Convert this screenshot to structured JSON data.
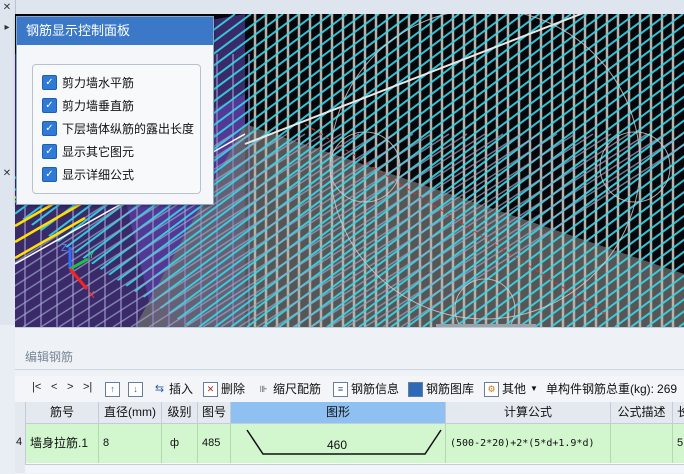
{
  "panel": {
    "title": "钢筋显示控制面板",
    "options": [
      {
        "label": "剪力墙水平筋",
        "checked": true
      },
      {
        "label": "剪力墙垂直筋",
        "checked": true
      },
      {
        "label": "下层墙体纵筋的露出长度",
        "checked": true
      },
      {
        "label": "显示其它图元",
        "checked": true
      },
      {
        "label": "显示详细公式",
        "checked": true
      }
    ]
  },
  "axis": {
    "z": "Z",
    "y": "Y",
    "x": "X"
  },
  "edit": {
    "title": "编辑钢筋",
    "toolbar": {
      "nav_first": "|<",
      "nav_prev": "<",
      "nav_next": ">",
      "nav_last": ">|",
      "insert": "插入",
      "delete": "删除",
      "scale": "缩尺配筋",
      "info": "钢筋信息",
      "library": "钢筋图库",
      "other": "其他",
      "total_label": "单构件钢筋总重(kg):",
      "total_value": "269"
    },
    "columns": [
      "筋号",
      "直径(mm)",
      "级别",
      "图号",
      "图形",
      "计算公式",
      "公式描述",
      "长"
    ],
    "rows": [
      {
        "row_no": "4",
        "name": "墙身拉筋.1",
        "diameter": "8",
        "grade": "ф",
        "fig_no": "485",
        "shape_len": "460",
        "formula": "(500-2*20)+2*(5*d+1.9*d)",
        "desc": "",
        "length": "5"
      }
    ]
  },
  "colors": {
    "accent": "#3c78c8",
    "row_bg": "#d2f7cf",
    "selected_header": "#8fc0f2"
  }
}
